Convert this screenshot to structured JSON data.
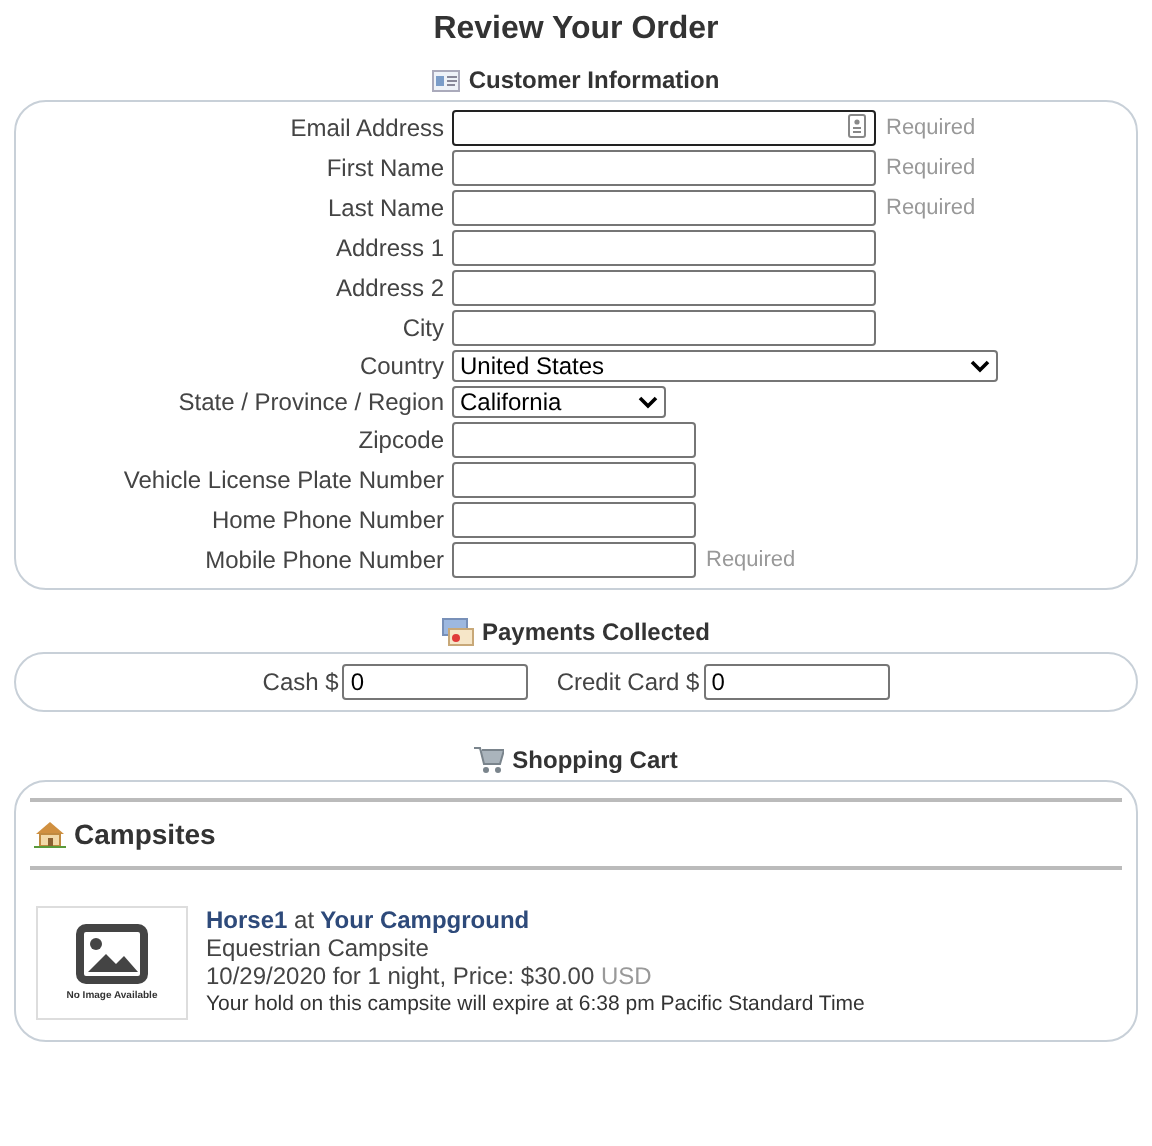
{
  "title": "Review Your Order",
  "customer": {
    "heading": "Customer Information",
    "fields": [
      {
        "label": "Email Address",
        "kind": "long_text",
        "required": "Required",
        "autofill_icon": true
      },
      {
        "label": "First Name",
        "kind": "long_text",
        "required": "Required"
      },
      {
        "label": "Last Name",
        "kind": "long_text",
        "required": "Required"
      },
      {
        "label": "Address 1",
        "kind": "long_text"
      },
      {
        "label": "Address 2",
        "kind": "long_text"
      },
      {
        "label": "City",
        "kind": "long_text"
      },
      {
        "label": "Country",
        "kind": "wide_select",
        "value": "United States"
      },
      {
        "label": "State / Province / Region",
        "kind": "narrow_select",
        "value": "California"
      },
      {
        "label": "Zipcode",
        "kind": "short_text"
      },
      {
        "label": "Vehicle License Plate Number",
        "kind": "short_text"
      },
      {
        "label": "Home Phone Number",
        "kind": "short_text"
      },
      {
        "label": "Mobile Phone Number",
        "kind": "short_text",
        "required": "Required"
      }
    ]
  },
  "payments": {
    "heading": "Payments Collected",
    "fields": [
      {
        "label": "Cash $",
        "value": "0"
      },
      {
        "label": "Credit Card $",
        "value": "0"
      }
    ]
  },
  "cart": {
    "heading": "Shopping Cart",
    "category": "Campsites",
    "items": [
      {
        "image_caption": "No Image Available",
        "name": "Horse1",
        "connector": "at",
        "campground": "Your Campground",
        "type": "Equestrian Campsite",
        "dates_price": "10/29/2020 for 1 night, Price: $30.00",
        "currency": "USD",
        "hold": "Your hold on this campsite will expire at 6:38 pm Pacific Standard Time"
      }
    ]
  }
}
